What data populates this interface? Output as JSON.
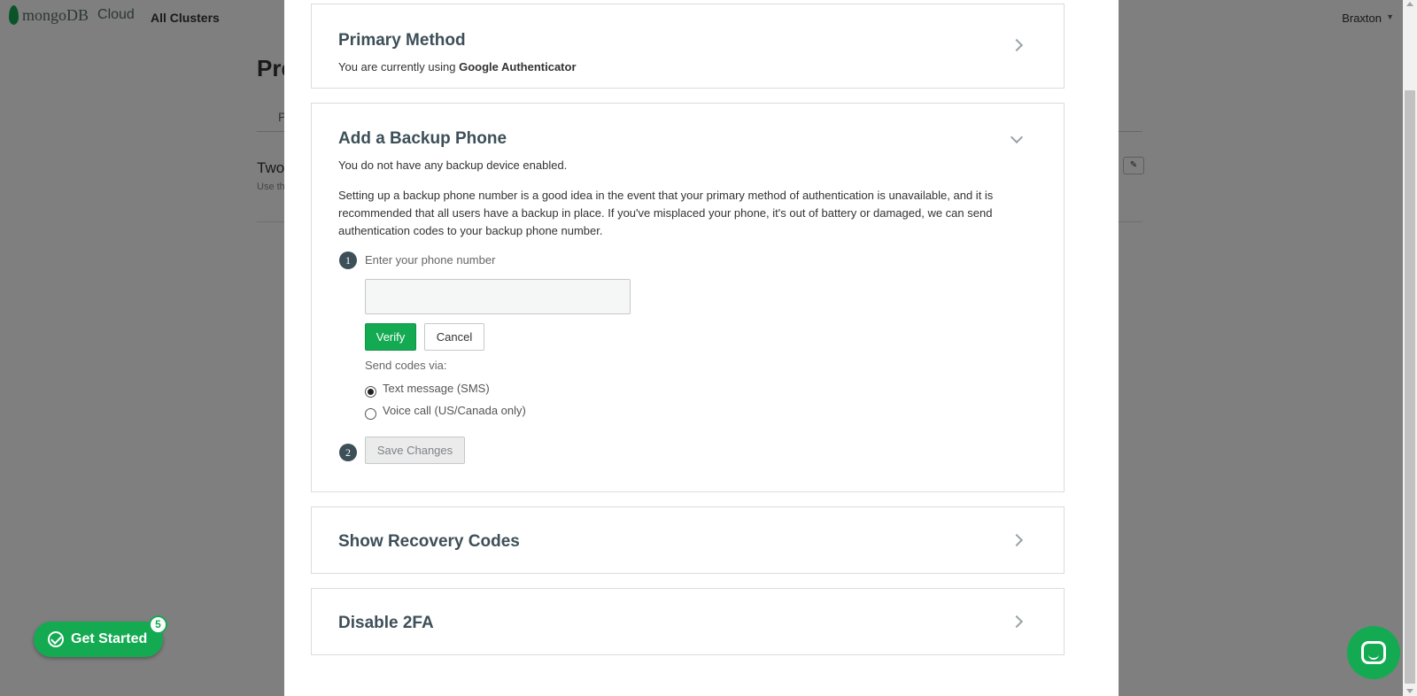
{
  "app": {
    "logo_text": "mongoDB",
    "logo_cloud": "Cloud",
    "nav_all_clusters": "All Clusters",
    "user_name": "Braxton",
    "page_title_partial": "Pre",
    "tab_partial": "P",
    "row_title_partial": "Two",
    "row_sub_partial": "Use th"
  },
  "modal": {
    "primary_method": {
      "title": "Primary Method",
      "desc_prefix": "You are currently using ",
      "desc_value": "Google Authenticator"
    },
    "backup_phone": {
      "title": "Add a Backup Phone",
      "status": "You do not have any backup device enabled.",
      "explanation": "Setting up a backup phone number is a good idea in the event that your primary method of authentication is unavailable, and it is recommended that all users have a backup in place. If you've misplaced your phone, it's out of battery or damaged, we can send authentication codes to your backup phone number.",
      "step1_number": "1",
      "step1_label": "Enter your phone number",
      "phone_value": "",
      "verify_label": "Verify",
      "cancel_label": "Cancel",
      "send_codes_label": "Send codes via:",
      "options": [
        {
          "label": "Text message (SMS)",
          "checked": true
        },
        {
          "label": "Voice call (US/Canada only)",
          "checked": false
        }
      ],
      "step2_number": "2",
      "save_label": "Save Changes"
    },
    "recovery_codes": {
      "title": "Show Recovery Codes"
    },
    "disable_2fa": {
      "title": "Disable 2FA"
    }
  },
  "floating": {
    "get_started_label": "Get Started",
    "get_started_badge": "5"
  },
  "colors": {
    "accent": "#13aa52",
    "overlay": "rgba(0,0,0,0.5)"
  }
}
